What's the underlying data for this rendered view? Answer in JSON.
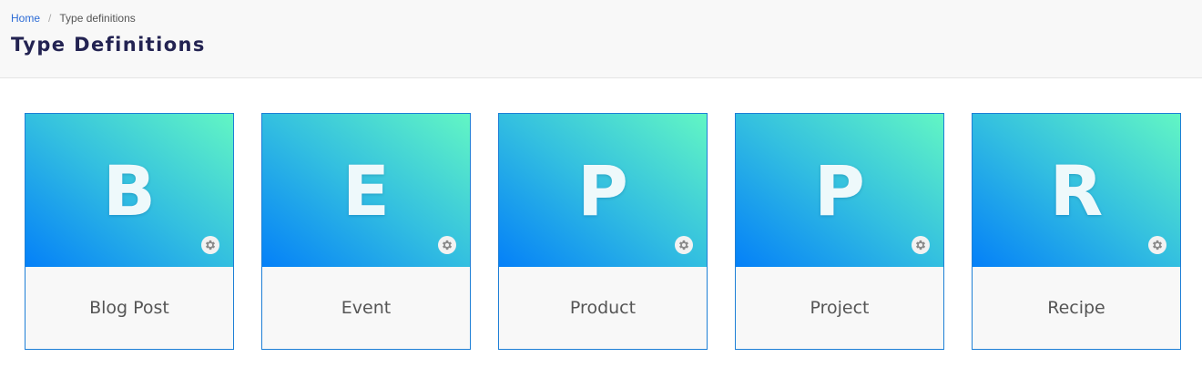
{
  "breadcrumb": {
    "home": "Home",
    "separator": "/",
    "current": "Type definitions"
  },
  "page": {
    "title": "Type Definitions"
  },
  "cards": [
    {
      "letter": "B",
      "label": "Blog Post",
      "settings_icon": "gear-icon"
    },
    {
      "letter": "E",
      "label": "Event",
      "settings_icon": "gear-icon"
    },
    {
      "letter": "P",
      "label": "Product",
      "settings_icon": "gear-icon"
    },
    {
      "letter": "P",
      "label": "Project",
      "settings_icon": "gear-icon"
    },
    {
      "letter": "R",
      "label": "Recipe",
      "settings_icon": "gear-icon"
    }
  ],
  "colors": {
    "gradient_start": "#0480f8",
    "gradient_end": "#62f6c4",
    "card_border": "#1e7fd6",
    "title": "#232352",
    "link": "#2c6bd6"
  }
}
